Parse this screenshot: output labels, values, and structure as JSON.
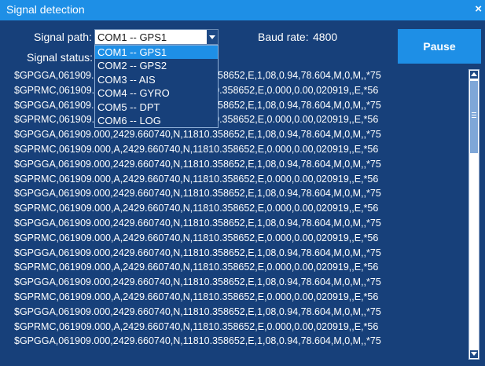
{
  "window": {
    "title": "Signal detection",
    "close_glyph": "×"
  },
  "form": {
    "signal_path_label": "Signal path:",
    "signal_path_value": "COM1 -- GPS1",
    "signal_status_label": "Signal status:",
    "baud_rate_label": "Baud rate:",
    "baud_rate_value": "4800"
  },
  "pause_button": {
    "label": "Pause"
  },
  "dropdown": {
    "options": [
      "COM1 -- GPS1",
      "COM2 -- GPS2",
      "COM3 -- AIS",
      "COM4 -- GYRO",
      "COM5 -- DPT",
      "COM6 -- LOG"
    ],
    "selected_index": 0
  },
  "log": {
    "lines": [
      "$GPGGA,061909.000,2429.660740,N,11810.358652,E,1,08,0.94,78.604,M,0,M,,*75",
      "$GPRMC,061909.000,A,2429.660740,N,11810.358652,E,0.000,0.00,020919,,E,*56",
      "$GPGGA,061909.000,2429.660740,N,11810.358652,E,1,08,0.94,78.604,M,0,M,,*75",
      "$GPRMC,061909.000,A,2429.660740,N,11810.358652,E,0.000,0.00,020919,,E,*56",
      "$GPGGA,061909.000,2429.660740,N,11810.358652,E,1,08,0.94,78.604,M,0,M,,*75",
      "$GPRMC,061909.000,A,2429.660740,N,11810.358652,E,0.000,0.00,020919,,E,*56",
      "$GPGGA,061909.000,2429.660740,N,11810.358652,E,1,08,0.94,78.604,M,0,M,,*75",
      "$GPRMC,061909.000,A,2429.660740,N,11810.358652,E,0.000,0.00,020919,,E,*56",
      "$GPGGA,061909.000,2429.660740,N,11810.358652,E,1,08,0.94,78.604,M,0,M,,*75",
      "$GPRMC,061909.000,A,2429.660740,N,11810.358652,E,0.000,0.00,020919,,E,*56",
      "$GPGGA,061909.000,2429.660740,N,11810.358652,E,1,08,0.94,78.604,M,0,M,,*75",
      "$GPRMC,061909.000,A,2429.660740,N,11810.358652,E,0.000,0.00,020919,,E,*56",
      "$GPGGA,061909.000,2429.660740,N,11810.358652,E,1,08,0.94,78.604,M,0,M,,*75",
      "$GPRMC,061909.000,A,2429.660740,N,11810.358652,E,0.000,0.00,020919,,E,*56",
      "$GPGGA,061909.000,2429.660740,N,11810.358652,E,1,08,0.94,78.604,M,0,M,,*75",
      "$GPRMC,061909.000,A,2429.660740,N,11810.358652,E,0.000,0.00,020919,,E,*56",
      "$GPGGA,061909.000,2429.660740,N,11810.358652,E,1,08,0.94,78.604,M,0,M,,*75",
      "$GPRMC,061909.000,A,2429.660740,N,11810.358652,E,0.000,0.00,020919,,E,*56",
      "$GPGGA,061909.000,2429.660740,N,11810.358652,E,1,08,0.94,78.604,M,0,M,,*75"
    ]
  },
  "colors": {
    "titlebar": "#1e8fe6",
    "background": "#17407a",
    "accent": "#1e8fe6",
    "text": "#ffffff"
  },
  "icons": [
    "close-icon",
    "dropdown-arrow-icon",
    "scroll-up-icon",
    "scroll-down-icon"
  ]
}
